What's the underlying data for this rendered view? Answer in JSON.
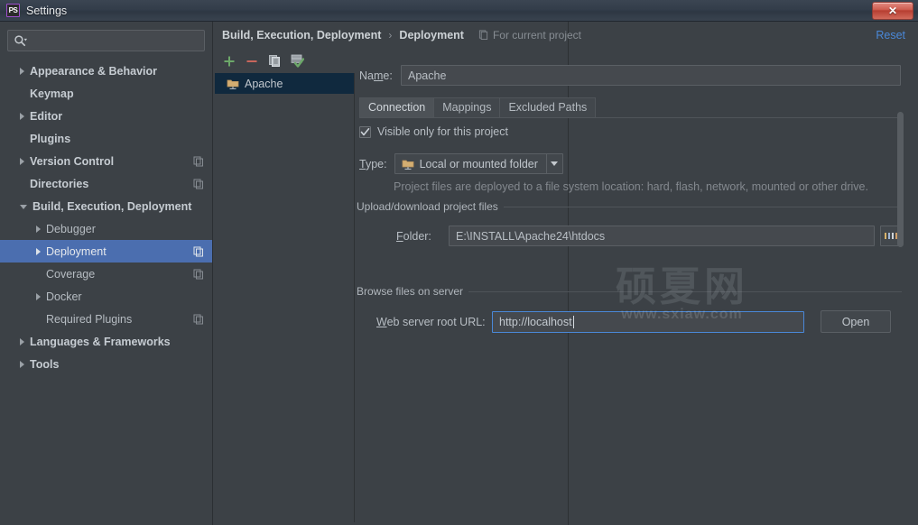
{
  "window": {
    "title": "Settings",
    "app_icon": "phpstorm-icon",
    "app_icon_label": "PS",
    "close_label": "✕"
  },
  "sidebar": {
    "search": {
      "placeholder": "",
      "value": "",
      "icon": "search-icon"
    },
    "items": [
      {
        "label": "Appearance & Behavior",
        "level": 0,
        "arrow": "right",
        "bold": true,
        "copy": false,
        "selected": false
      },
      {
        "label": "Keymap",
        "level": 0,
        "arrow": "none",
        "bold": true,
        "copy": false,
        "selected": false
      },
      {
        "label": "Editor",
        "level": 0,
        "arrow": "right",
        "bold": true,
        "copy": false,
        "selected": false
      },
      {
        "label": "Plugins",
        "level": 0,
        "arrow": "none",
        "bold": true,
        "copy": false,
        "selected": false
      },
      {
        "label": "Version Control",
        "level": 0,
        "arrow": "right",
        "bold": true,
        "copy": true,
        "selected": false
      },
      {
        "label": "Directories",
        "level": 0,
        "arrow": "none",
        "bold": true,
        "copy": true,
        "selected": false
      },
      {
        "label": "Build, Execution, Deployment",
        "level": 0,
        "arrow": "down",
        "bold": true,
        "copy": false,
        "selected": false
      },
      {
        "label": "Debugger",
        "level": 1,
        "arrow": "right",
        "bold": false,
        "copy": false,
        "selected": false
      },
      {
        "label": "Deployment",
        "level": 1,
        "arrow": "right",
        "bold": false,
        "copy": true,
        "selected": true
      },
      {
        "label": "Coverage",
        "level": 1,
        "arrow": "none",
        "bold": false,
        "copy": true,
        "selected": false
      },
      {
        "label": "Docker",
        "level": 1,
        "arrow": "right",
        "bold": false,
        "copy": false,
        "selected": false
      },
      {
        "label": "Required Plugins",
        "level": 1,
        "arrow": "none",
        "bold": false,
        "copy": true,
        "selected": false
      },
      {
        "label": "Languages & Frameworks",
        "level": 0,
        "arrow": "right",
        "bold": true,
        "copy": false,
        "selected": false
      },
      {
        "label": "Tools",
        "level": 0,
        "arrow": "right",
        "bold": true,
        "copy": false,
        "selected": false
      }
    ]
  },
  "header": {
    "crumb_root": "Build, Execution, Deployment",
    "crumb_sep": "›",
    "crumb_current": "Deployment",
    "scope_note": "For current project",
    "scope_icon": "project-scope-icon",
    "reset_label": "Reset"
  },
  "server_panel": {
    "toolbar": [
      {
        "name": "add-server-button",
        "glyph": "+",
        "color": "#6ca869"
      },
      {
        "name": "remove-server-button",
        "glyph": "−",
        "color": "#c8665c"
      },
      {
        "name": "copy-server-button",
        "glyph": "copy-icon",
        "color": "#9aa0a6"
      },
      {
        "name": "set-default-server-button",
        "glyph": "server-check-icon",
        "color": "#6ca869"
      }
    ],
    "servers": [
      {
        "label": "Apache",
        "icon": "local-folder-server-icon",
        "selected": true
      }
    ]
  },
  "form": {
    "name_label": "Name:",
    "name_mnemonic": "m",
    "name_value": "Apache",
    "tabs": [
      {
        "label": "Connection",
        "active": true
      },
      {
        "label": "Mappings",
        "active": false
      },
      {
        "label": "Excluded Paths",
        "active": false
      }
    ],
    "visible_only_checkbox": {
      "label": "Visible only for this project",
      "checked": true,
      "check_glyph": "✓"
    },
    "type_label": "Type:",
    "type_mnemonic": "T",
    "type_value": "Local or mounted folder",
    "type_icon": "local-folder-server-icon",
    "hint": "Project files are deployed to a file system location: hard, flash, network, mounted or other drive.",
    "upload_group_label": "Upload/download project files",
    "folder_label": "Folder:",
    "folder_mnemonic": "F",
    "folder_value": "E:\\INSTALL\\Apache24\\htdocs",
    "folder_browse_label": "...",
    "browse_group_label": "Browse files on server",
    "url_label": "Web server root URL:",
    "url_mnemonic": "W",
    "url_value": "http://localhost",
    "open_button_label": "Open"
  },
  "watermark": {
    "cn": "硕夏网",
    "en": "www.sxiaw.com"
  },
  "colors": {
    "accent_blue": "#4b6eaf",
    "link_blue": "#4a88d8",
    "panel_bg": "#3c4146",
    "selected_server_bg": "#10293e",
    "add_green": "#6ca869",
    "remove_red": "#c8665c"
  }
}
